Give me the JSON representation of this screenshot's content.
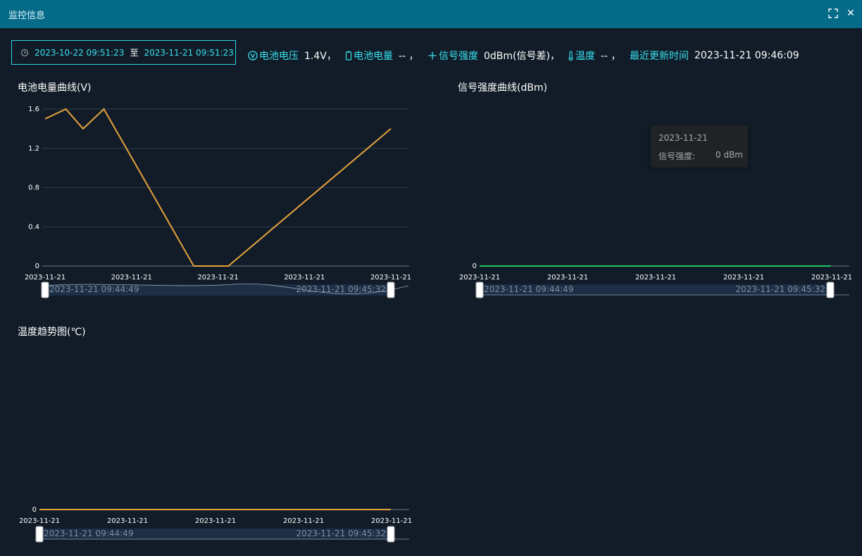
{
  "window": {
    "title": "监控信息",
    "fullscreen_icon": "fullscreen-icon",
    "close_icon": "close-icon"
  },
  "date_range": {
    "start": "2023-10-22 09:51:23",
    "separator": "至",
    "end": "2023-11-21 09:51:23",
    "icon": "clock-icon"
  },
  "status": {
    "voltage": {
      "label": "电池电压",
      "value": "1.4V，",
      "icon": "voltage-icon"
    },
    "battery": {
      "label": "电池电量",
      "value": "-- ，",
      "icon": "battery-icon"
    },
    "signal": {
      "label": "信号强度",
      "value": "0dBm(信号差)，",
      "icon": "signal-icon"
    },
    "temperature": {
      "label": "温度",
      "value": "-- ，",
      "icon": "thermometer-icon"
    },
    "updated": {
      "label": "最近更新时间",
      "value": "2023-11-21 09:46:09"
    }
  },
  "colors": {
    "accent": "#38e0ee",
    "battery_line": "#e6a23c",
    "signal_line": "#22c55e",
    "temp_line": "#e6a23c",
    "titlebar": "#066b89"
  },
  "charts": {
    "battery": {
      "title": "电池电量曲线(V)",
      "slider_start": "2023-11-21 09:44:49",
      "slider_end": "2023-11-21 09:45:32"
    },
    "signal": {
      "title": "信号强度曲线(dBm)",
      "slider_start": "2023-11-21 09:44:49",
      "slider_end": "2023-11-21 09:45:32",
      "tooltip": {
        "date": "2023-11-21",
        "label": "信号强度:",
        "value": "0 dBm"
      }
    },
    "temperature": {
      "title": "温度趋势图(℃)",
      "slider_start": "2023-11-21 09:44:49",
      "slider_end": "2023-11-21 09:45:32"
    }
  },
  "chart_data": [
    {
      "type": "line",
      "title": "电池电量曲线(V)",
      "x_tick_labels": [
        "2023-11-21",
        "2023-11-21",
        "2023-11-21",
        "2023-11-21",
        "2023-11-21"
      ],
      "y_ticks": [
        0,
        0.4,
        0.8,
        1.2,
        1.6
      ],
      "ylim": [
        0,
        1.6
      ],
      "grid": true,
      "series": [
        {
          "values": [
            1.5,
            1.6,
            1.4,
            1.6,
            0,
            0,
            1.4
          ],
          "x_frac": [
            0,
            0.06,
            0.11,
            0.17,
            0.43,
            0.53,
            1.0
          ]
        }
      ]
    },
    {
      "type": "line",
      "title": "信号强度曲线(dBm)",
      "x_tick_labels": [
        "2023-11-21",
        "2023-11-21",
        "2023-11-21",
        "2023-11-21",
        "2023-11-21"
      ],
      "y_ticks": [
        0
      ],
      "series": [
        {
          "values": [
            0,
            0,
            0,
            0,
            0,
            0,
            0
          ],
          "x_frac": [
            0,
            0.06,
            0.11,
            0.17,
            0.43,
            0.53,
            1.0
          ]
        }
      ]
    },
    {
      "type": "line",
      "title": "温度趋势图(℃)",
      "x_tick_labels": [
        "2023-11-21",
        "2023-11-21",
        "2023-11-21",
        "2023-11-21",
        "2023-11-21"
      ],
      "y_ticks": [
        0
      ],
      "series": [
        {
          "values": [
            0,
            0,
            0,
            0,
            0,
            0,
            0
          ],
          "x_frac": [
            0,
            0.06,
            0.11,
            0.17,
            0.43,
            0.53,
            1.0
          ]
        }
      ]
    }
  ]
}
